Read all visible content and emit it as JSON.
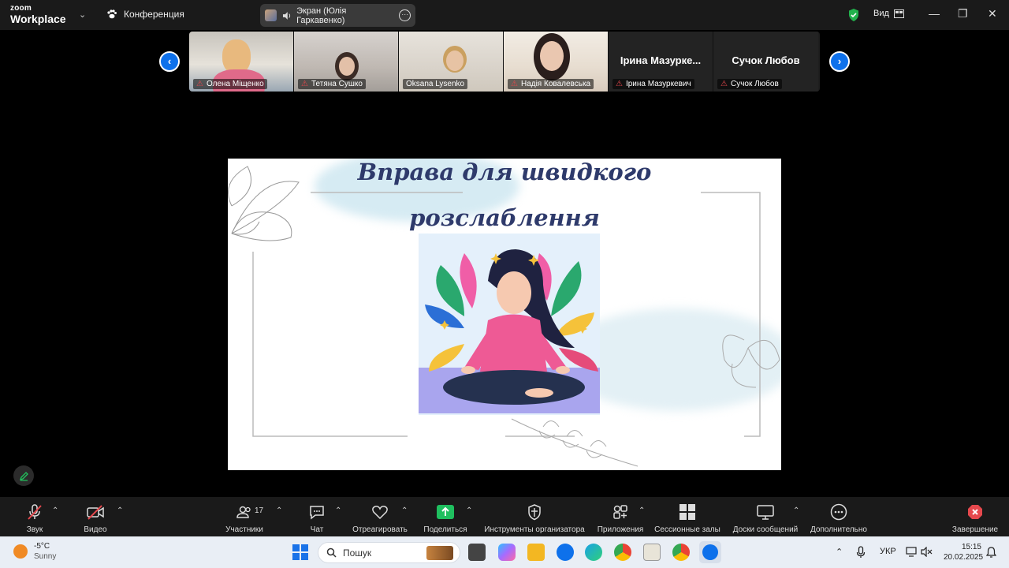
{
  "titlebar": {
    "logo_top": "zoom",
    "logo_bottom": "Workplace",
    "conference_label": "Конференция",
    "screen_share_label": "Экран (Юлія Гаркавенко)",
    "view_label": "Вид",
    "icons": [
      "chevron-down-icon",
      "paw-icon",
      "speaker-icon",
      "more-icon",
      "shield-icon",
      "view-grid-icon",
      "minimize-icon",
      "restore-icon",
      "close-icon"
    ]
  },
  "participants_strip": {
    "tiles": [
      {
        "name": "Олена Міщенко",
        "muted": true
      },
      {
        "name": "Тетяна Сушко",
        "muted": true
      },
      {
        "name": "Oksana Lysenko",
        "muted": false
      },
      {
        "name": "Надія Ковалевська",
        "muted": true
      },
      {
        "name": "Ірина Мазуркевич",
        "display": "Ірина  Мазурке...",
        "muted": true
      },
      {
        "name": "Сучок Любов",
        "display": "Сучок Любов",
        "muted": true
      }
    ]
  },
  "slide": {
    "title_line1": "Вправа для швидкого",
    "title_line2": "розслаблення"
  },
  "toolbar": {
    "audio": "Звук",
    "video": "Видео",
    "participants": "Участники",
    "participants_count": "17",
    "chat": "Чат",
    "react": "Отреагировать",
    "share": "Поделиться",
    "host_tools": "Инструменты организатора",
    "apps": "Приложения",
    "breakout": "Сессионные залы",
    "whiteboards": "Доски сообщений",
    "more": "Дополнительно",
    "end": "Завершение"
  },
  "taskbar": {
    "weather_temp": "-5°C",
    "weather_desc": "Sunny",
    "search_placeholder": "Пошук",
    "lang": "УКР",
    "time": "15:15",
    "date": "20.02.2025",
    "colors": {
      "zoom_blue": "#0e71eb",
      "share_green": "#1fbf5f",
      "end_red": "#e5484d",
      "slide_title": "#2e3a6b"
    }
  }
}
